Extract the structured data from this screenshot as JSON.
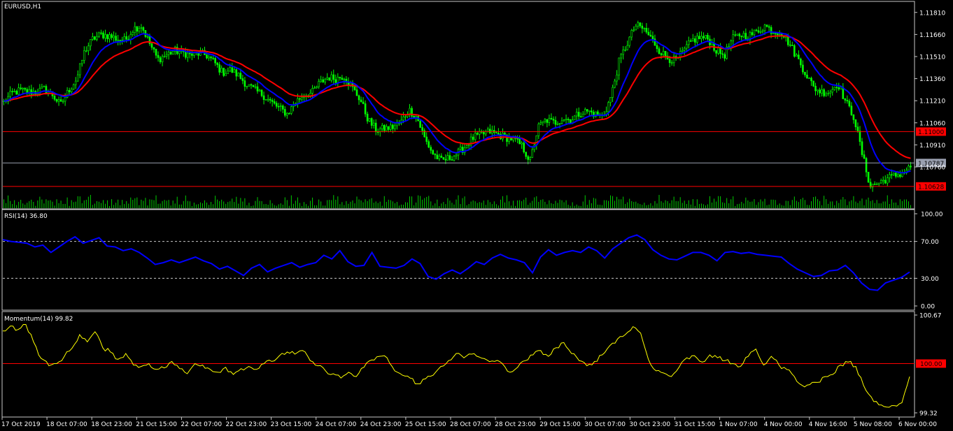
{
  "colors": {
    "background": "#000000",
    "frame": "#c8c8c8",
    "bull_candle": "#00ff00",
    "volume": "#00cc00",
    "fast_ma": "#0000ff",
    "slow_ma": "#ff0000",
    "price_level_line": "#ff0000",
    "current_price_line": "#9aa0b0",
    "rsi_line": "#0000ff",
    "momentum_line": "#ffff00",
    "label_bg_red": "#ff0000",
    "label_bg_grey": "#9aa0b0"
  },
  "chart_data": [
    {
      "type": "candlestick",
      "title": "EURUSD,H1",
      "ylim": [
        1.1048,
        1.1188
      ],
      "y_ticks": [
        "1.11810",
        "1.11660",
        "1.11510",
        "1.11360",
        "1.11210",
        "1.11060",
        "1.10910",
        "1.10760"
      ],
      "x_ticks": [
        "17 Oct 2019",
        "18 Oct 07:00",
        "18 Oct 23:00",
        "21 Oct 15:00",
        "22 Oct 07:00",
        "22 Oct 23:00",
        "23 Oct 15:00",
        "24 Oct 07:00",
        "24 Oct 23:00",
        "25 Oct 15:00",
        "28 Oct 07:00",
        "28 Oct 23:00",
        "29 Oct 15:00",
        "30 Oct 07:00",
        "30 Oct 23:00",
        "31 Oct 15:00",
        "1 Nov 07:00",
        "4 Nov 00:00",
        "4 Nov 16:00",
        "5 Nov 08:00",
        "6 Nov 00:00"
      ],
      "close_path": [
        1.112,
        1.1126,
        1.1128,
        1.1127,
        1.1127,
        1.1129,
        1.1125,
        1.1118,
        1.1128,
        1.1136,
        1.1155,
        1.1163,
        1.1166,
        1.1165,
        1.1163,
        1.1162,
        1.117,
        1.1172,
        1.116,
        1.1149,
        1.1152,
        1.1155,
        1.1154,
        1.1152,
        1.1153,
        1.1152,
        1.1147,
        1.114,
        1.1142,
        1.1138,
        1.1132,
        1.1128,
        1.1125,
        1.112,
        1.1116,
        1.1112,
        1.112,
        1.1125,
        1.1126,
        1.1133,
        1.1137,
        1.1136,
        1.1138,
        1.113,
        1.1122,
        1.1108,
        1.1101,
        1.1102,
        1.1103,
        1.1106,
        1.1115,
        1.111,
        1.1095,
        1.1085,
        1.108,
        1.1082,
        1.1085,
        1.109,
        1.1096,
        1.1098,
        1.11,
        1.1098,
        1.1096,
        1.1095,
        1.109,
        1.108,
        1.1103,
        1.1108,
        1.1106,
        1.1109,
        1.1108,
        1.1112,
        1.1114,
        1.1112,
        1.111,
        1.1124,
        1.1148,
        1.116,
        1.1172,
        1.117,
        1.1163,
        1.1155,
        1.115,
        1.1148,
        1.1155,
        1.1162,
        1.1164,
        1.1163,
        1.1155,
        1.1152,
        1.1163,
        1.1166,
        1.1165,
        1.1168,
        1.1172,
        1.1168,
        1.1168,
        1.116,
        1.115,
        1.114,
        1.113,
        1.1127,
        1.1127,
        1.1133,
        1.112,
        1.111,
        1.1085,
        1.1063,
        1.1065,
        1.1068,
        1.107,
        1.1072,
        1.1076
      ],
      "price_lines": [
        {
          "value": 1.11,
          "label": "1.11000",
          "style": "red"
        },
        {
          "value": 1.10787,
          "label": "1.10787",
          "style": "grey"
        },
        {
          "value": 1.10628,
          "label": "1.10628",
          "style": "red"
        }
      ]
    },
    {
      "type": "line",
      "title": "RSI(14) 36.80",
      "ylim": [
        0,
        100
      ],
      "y_ticks": [
        "100.00",
        "70.00",
        "30.00",
        "0.00"
      ],
      "levels": [
        70,
        30
      ],
      "values": [
        72,
        70,
        69,
        68,
        64,
        66,
        58,
        64,
        70,
        75,
        68,
        71,
        74,
        65,
        64,
        60,
        62,
        58,
        52,
        45,
        47,
        50,
        47,
        50,
        53,
        49,
        46,
        40,
        43,
        38,
        33,
        41,
        45,
        37,
        41,
        44,
        47,
        42,
        45,
        47,
        55,
        51,
        60,
        48,
        43,
        44,
        58,
        43,
        42,
        41,
        44,
        51,
        46,
        32,
        29,
        35,
        39,
        35,
        41,
        48,
        45,
        52,
        56,
        52,
        50,
        47,
        36,
        53,
        61,
        55,
        58,
        60,
        58,
        64,
        60,
        52,
        62,
        68,
        74,
        77,
        72,
        61,
        55,
        51,
        50,
        54,
        58,
        58,
        55,
        49,
        58,
        59,
        57,
        58,
        56,
        55,
        54,
        53,
        46,
        40,
        36,
        32,
        33,
        38,
        39,
        44,
        36,
        25,
        18,
        17,
        25,
        28,
        31,
        36.8
      ]
    },
    {
      "type": "line",
      "title": "Momentum(14) 99.82",
      "ylim": [
        99.32,
        100.67
      ],
      "y_ticks": [
        "100.67",
        "99.32"
      ],
      "levels": [
        100.0
      ],
      "level_label": "100.00",
      "values": [
        100.45,
        100.52,
        100.47,
        100.54,
        100.3,
        100.07,
        99.97,
        100.0,
        100.1,
        100.21,
        100.4,
        100.3,
        100.44,
        100.22,
        100.16,
        100.06,
        100.14,
        99.98,
        99.96,
        100.0,
        99.92,
        99.94,
        100.03,
        99.93,
        99.86,
        100.0,
        99.98,
        99.92,
        99.88,
        99.95,
        99.85,
        99.93,
        99.96,
        99.92,
        100.0,
        100.03,
        100.11,
        100.16,
        100.13,
        100.18,
        100.04,
        99.97,
        99.9,
        99.86,
        99.8,
        99.88,
        99.82,
        99.95,
        100.05,
        100.1,
        100.08,
        99.9,
        99.84,
        99.8,
        99.72,
        99.79,
        99.84,
        99.96,
        100.04,
        100.14,
        100.08,
        100.13,
        100.09,
        100.05,
        100.03,
        100.0,
        99.88,
        99.95,
        100.04,
        100.12,
        100.18,
        100.1,
        100.22,
        100.29,
        100.14,
        100.04,
        99.97,
        100.03,
        100.12,
        100.25,
        100.34,
        100.4,
        100.51,
        100.42,
        100.06,
        99.9,
        99.87,
        99.82,
        99.95,
        100.08,
        100.11,
        100.02,
        100.12,
        100.08,
        100.04,
        100.0,
        99.96,
        100.1,
        100.2,
        99.98,
        100.1,
        99.98,
        99.92,
        99.82,
        99.7,
        99.71,
        99.74,
        99.82,
        99.85,
        99.98,
        100.02,
        99.96,
        99.7,
        99.54,
        99.43,
        99.4,
        99.42,
        99.46,
        99.82
      ]
    }
  ]
}
